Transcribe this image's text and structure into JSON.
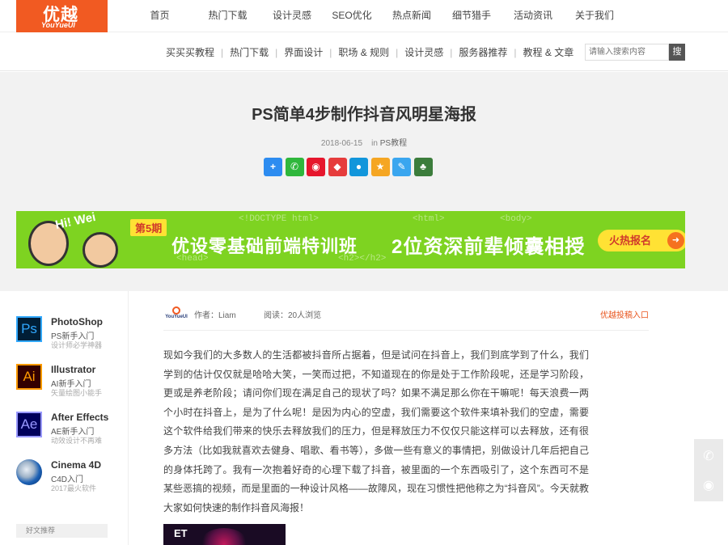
{
  "logo": {
    "cn": "优越",
    "en": "YouYueUI"
  },
  "main_nav": [
    "首页",
    "热门下载",
    "设计灵感",
    "SEO优化",
    "热点新闻",
    "细节猎手",
    "活动资讯",
    "关于我们"
  ],
  "sub_nav": [
    "买买买教程",
    "热门下载",
    "界面设计",
    "职场 & 规则",
    "设计灵感",
    "服务器推荐",
    "教程 & 文章"
  ],
  "search": {
    "placeholder": "请输入搜索内容",
    "button": "搜"
  },
  "article": {
    "title": "PS简单4步制作抖音风明星海报",
    "date": "2018-06-15",
    "category_prefix": "in",
    "category": "PS教程",
    "author": "作者：Liam",
    "reads": "阅读：20人浏览",
    "submit_link": "优越投稿入口",
    "body": "现如今我们的大多数人的生活都被抖音所占据着，但是试问在抖音上，我们到底学到了什么，我们学到的估计仅仅就是哈哈大笑，一笑而过把，不知道现在的你是处于工作阶段呢，还是学习阶段，更或是养老阶段；请问你们现在满足自己的现状了吗？如果不满足那么你在干嘛呢！每天浪费一两个小时在抖音上，是为了什么呢！是因为内心的空虚，我们需要这个软件来填补我们的空虚，需要这个软件给我们带来的快乐去释放我们的压力，但是释放压力不仅仅只能这样可以去释放，还有很多方法（比如我就喜欢去健身、唱歌、看书等），多做一些有意义的事情把，别做设计几年后把自己的身体托跨了。我有一次抱着好奇的心理下载了抖音，被里面的一个东西吸引了，这个东西可不是某些恶搞的视频，而是里面的一种设计风格——故障风，现在习惯性把他称之为“抖音风”。今天就教大家如何快速的制作抖音风海报！",
    "thumb_text": "ET"
  },
  "share_icons": [
    {
      "name": "more-share-icon",
      "glyph": "+",
      "color": "#2d8cf0"
    },
    {
      "name": "wechat-icon",
      "glyph": "✆",
      "color": "#2fb73c"
    },
    {
      "name": "weibo-icon",
      "glyph": "◉",
      "color": "#e6162d"
    },
    {
      "name": "netease-icon",
      "glyph": "◆",
      "color": "#e63c3c"
    },
    {
      "name": "qq-icon",
      "glyph": "●",
      "color": "#1296db"
    },
    {
      "name": "qzone-icon",
      "glyph": "★",
      "color": "#f5a623"
    },
    {
      "name": "pencil-icon",
      "glyph": "✎",
      "color": "#3aa6ef"
    },
    {
      "name": "evernote-icon",
      "glyph": "♣",
      "color": "#3c7d3c"
    }
  ],
  "banner": {
    "greeting": "Hi! Wei",
    "period": "第5期",
    "headline": "优设零基础前端特训班",
    "tagline": "2位资深前辈倾囊相授",
    "cta": "火热报名",
    "code_tags": [
      "<!DOCTYPE html>",
      "<html>",
      "<body>",
      "<head>",
      "<h2></h2>"
    ]
  },
  "apps": [
    {
      "abbr": "Ps",
      "name": "PhotoShop",
      "sub1": "PS新手入门",
      "sub2": "设计师必学神器",
      "color": "#31a8ff",
      "bg": "#001e36"
    },
    {
      "abbr": "Ai",
      "name": "Illustrator",
      "sub1": "AI新手入门",
      "sub2": "矢量绘图小能手",
      "color": "#ff9a00",
      "bg": "#330000"
    },
    {
      "abbr": "Ae",
      "name": "After Effects",
      "sub1": "AE新手入门",
      "sub2": "动效设计不再难",
      "color": "#9999ff",
      "bg": "#00005b"
    },
    {
      "abbr": "C4D",
      "name": "Cinema 4D",
      "sub1": "C4D入门",
      "sub2": "2017最火软件",
      "color": "#1a5fb4",
      "bg": "#cfd8e3"
    }
  ],
  "sidebar_section": "好文推荐",
  "float": {
    "wechat": "wechat-icon",
    "weibo": "weibo-icon"
  }
}
